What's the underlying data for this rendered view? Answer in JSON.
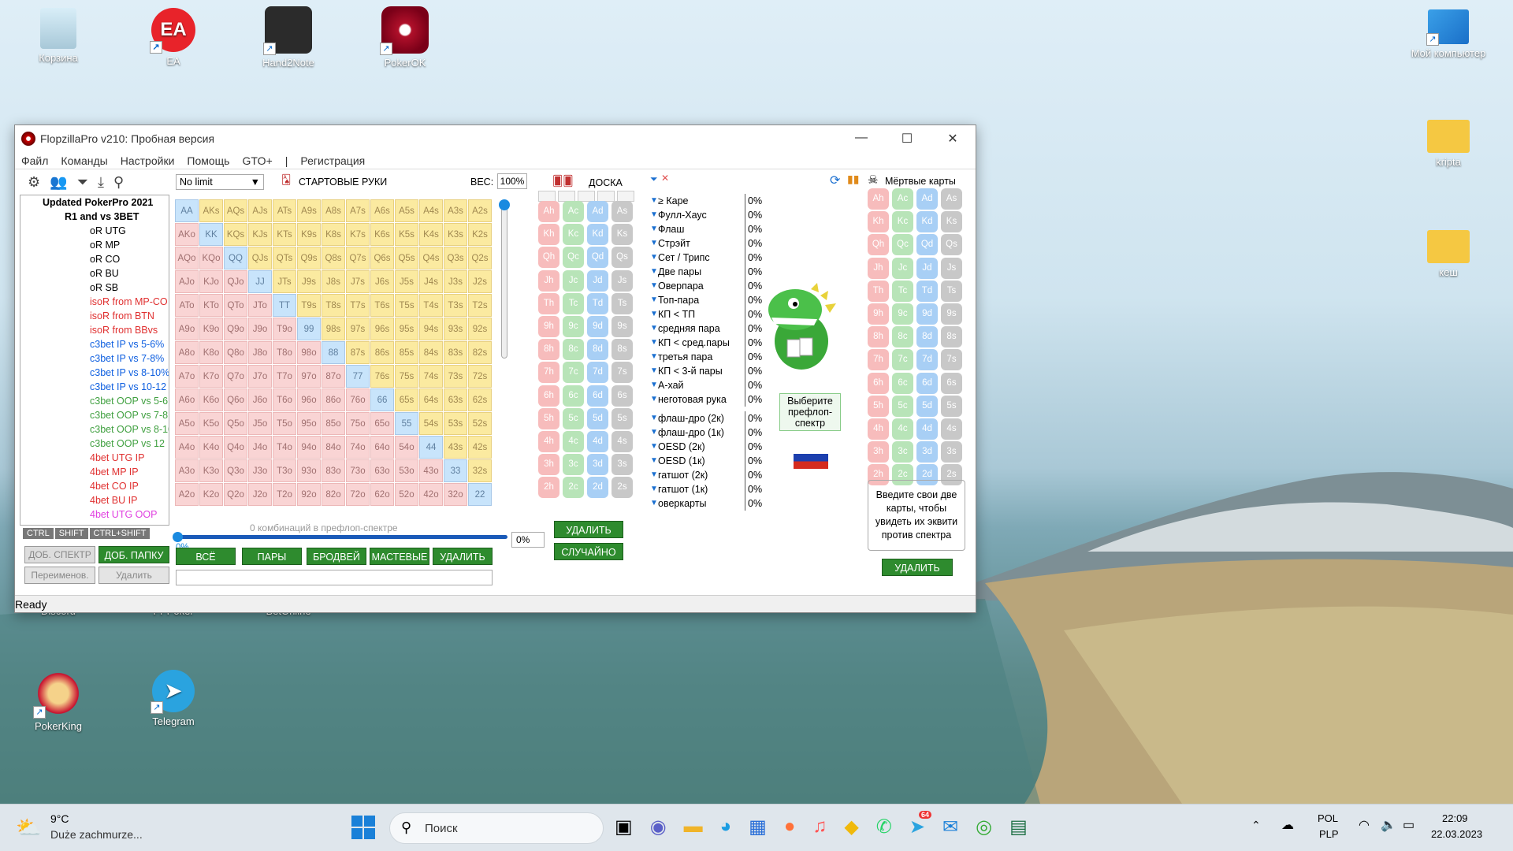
{
  "desktop": {
    "icons": [
      {
        "label": "Корзина"
      },
      {
        "label": "EA"
      },
      {
        "label": "Hand2Note"
      },
      {
        "label": "PokerOK"
      },
      {
        "label": "Мой компьютер"
      },
      {
        "label": "kripta"
      },
      {
        "label": "кеш"
      },
      {
        "label": "Discord"
      },
      {
        "label": "PPPoker"
      },
      {
        "label": "BetOnline"
      },
      {
        "label": "PokerKing"
      },
      {
        "label": "Telegram"
      }
    ]
  },
  "window": {
    "title": "FlopzillaPro v210: Пробная версия",
    "menu": [
      "Файл",
      "Команды",
      "Настройки",
      "Помощь",
      "GTO+",
      "|",
      "Регистрация"
    ],
    "status": "Ready"
  },
  "tree": {
    "root": "Updated PokerPro 2021",
    "sub": "R1 and vs 3BET",
    "items": [
      {
        "label": "oR UTG",
        "color": "black"
      },
      {
        "label": "oR MP",
        "color": "black"
      },
      {
        "label": "oR CO",
        "color": "black"
      },
      {
        "label": "oR BU",
        "color": "black"
      },
      {
        "label": "oR SB",
        "color": "black"
      },
      {
        "label": "isoR from MP-CO",
        "color": "red"
      },
      {
        "label": "isoR from BTN",
        "color": "red"
      },
      {
        "label": "isoR from BBvs",
        "color": "red"
      },
      {
        "label": "c3bet IP vs 5-6%",
        "color": "blue"
      },
      {
        "label": "c3bet IP vs 7-8%",
        "color": "blue"
      },
      {
        "label": "c3bet IP vs 8-10%",
        "color": "blue"
      },
      {
        "label": "c3bet IP vs 10-12",
        "color": "blue"
      },
      {
        "label": "c3bet OOP vs 5-6",
        "color": "green"
      },
      {
        "label": "c3bet OOP vs 7-8",
        "color": "green"
      },
      {
        "label": "c3bet OOP vs 8-10",
        "color": "green"
      },
      {
        "label": "c3bet OOP vs 12",
        "color": "green"
      },
      {
        "label": "4bet UTG IP",
        "color": "red"
      },
      {
        "label": "4bet MP IP",
        "color": "red"
      },
      {
        "label": "4bet CO IP",
        "color": "red"
      },
      {
        "label": "4bet BU IP",
        "color": "red"
      },
      {
        "label": "4bet UTG OOP",
        "color": "mag"
      }
    ]
  },
  "modkeys": [
    "CTRL",
    "SHIFT",
    "CTRL+SHIFT"
  ],
  "left_buttons": {
    "add_range": "ДОБ. СПЕКТР",
    "add_folder": "ДОБ. ПАПКУ",
    "rename": "Переименов.",
    "delete": "Удалить"
  },
  "range": {
    "game": "No limit",
    "title": "СТАРТОВЫЕ РУКИ",
    "weight_label": "ВЕС:",
    "weight": "100%",
    "combos_text": "0 комбинаций в префлоп-спектре",
    "slider_pct": "0%",
    "pct_box": "0%",
    "buttons": [
      "ВСЁ",
      "ПАРЫ",
      "БРОДВЕЙ",
      "МАСТЕВЫЕ",
      "УДАЛИТЬ"
    ],
    "ranks": [
      "A",
      "K",
      "Q",
      "J",
      "T",
      "9",
      "8",
      "7",
      "6",
      "5",
      "4",
      "3",
      "2"
    ]
  },
  "board": {
    "title": "ДОСКА",
    "ranks": [
      "A",
      "K",
      "Q",
      "J",
      "T",
      "9",
      "8",
      "7",
      "6",
      "5",
      "4",
      "3",
      "2"
    ],
    "suits": [
      "h",
      "c",
      "d",
      "s"
    ],
    "delete": "УДАЛИТЬ",
    "random": "СЛУЧАЙНО"
  },
  "stats": {
    "made": [
      {
        "label": "≥ Каре",
        "pct": "0%"
      },
      {
        "label": "Фулл-Хаус",
        "pct": "0%"
      },
      {
        "label": "Флаш",
        "pct": "0%"
      },
      {
        "label": "Стрэйт",
        "pct": "0%"
      },
      {
        "label": "Сет / Трипс",
        "pct": "0%"
      },
      {
        "label": "Две пары",
        "pct": "0%"
      },
      {
        "label": "Оверпара",
        "pct": "0%"
      },
      {
        "label": "Топ-пара",
        "pct": "0%"
      },
      {
        "label": "КП < ТП",
        "pct": "0%"
      },
      {
        "label": "средняя пара",
        "pct": "0%"
      },
      {
        "label": "КП < сред.пары",
        "pct": "0%"
      },
      {
        "label": "третья пара",
        "pct": "0%"
      },
      {
        "label": "КП < 3-й пары",
        "pct": "0%"
      },
      {
        "label": "А-хай",
        "pct": "0%"
      },
      {
        "label": "неготовая рука",
        "pct": "0%"
      }
    ],
    "draws": [
      {
        "label": "флаш-дро (2к)",
        "pct": "0%"
      },
      {
        "label": "флаш-дро (1к)",
        "pct": "0%"
      },
      {
        "label": "OESD (2к)",
        "pct": "0%"
      },
      {
        "label": "OESD (1к)",
        "pct": "0%"
      },
      {
        "label": "гатшот (2к)",
        "pct": "0%"
      },
      {
        "label": "гатшот (1к)",
        "pct": "0%"
      },
      {
        "label": "оверкарты",
        "pct": "0%"
      }
    ]
  },
  "mascot": {
    "bubble": "Выберите префлоп-спектр"
  },
  "dead": {
    "title": "Мёртвые карты",
    "hint": "Введите свои две карты, чтобы увидеть их эквити против спектра",
    "delete": "УДАЛИТЬ"
  },
  "taskbar": {
    "weather_temp": "9°C",
    "weather_text": "Duże zachmurze...",
    "search": "Поиск",
    "lang1": "POL",
    "lang2": "PLP",
    "time": "22:09",
    "date": "22.03.2023",
    "telegram_badge": "64"
  }
}
